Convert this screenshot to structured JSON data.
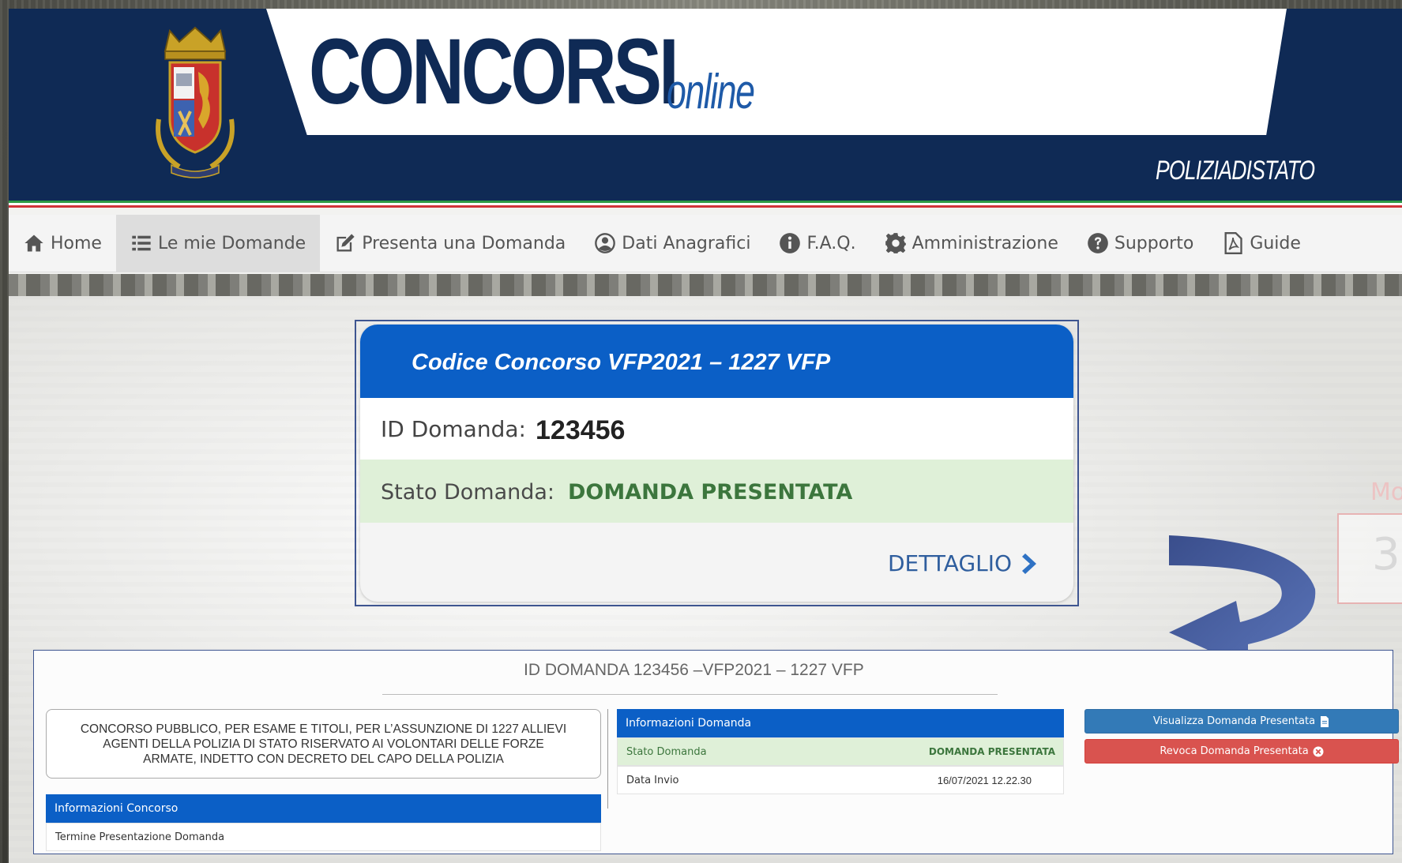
{
  "brand": {
    "title_main": "CONCORSI",
    "title_sub": "online",
    "right_label": "POLIZIADISTATO"
  },
  "colors": {
    "header_navy": "#0f2a55",
    "card_blue": "#0b5fc6",
    "success_bg": "#dff0d8",
    "success_text": "#3c763d",
    "tricolor": [
      "#2e9a46",
      "#ffffff",
      "#d1333a"
    ]
  },
  "nav": {
    "items": [
      {
        "label": "Home",
        "icon": "home-icon"
      },
      {
        "label": "Le mie Domande",
        "icon": "list-icon",
        "active": true
      },
      {
        "label": "Presenta una Domanda",
        "icon": "edit-icon"
      },
      {
        "label": "Dati Anagrafici",
        "icon": "user-circle-icon"
      },
      {
        "label": "F.A.Q.",
        "icon": "info-icon"
      },
      {
        "label": "Amministrazione",
        "icon": "gear-icon"
      },
      {
        "label": "Supporto",
        "icon": "question-icon"
      },
      {
        "label": "Guide",
        "icon": "pdf-icon"
      }
    ]
  },
  "card": {
    "header": "Codice Concorso VFP2021 – 1227 VFP",
    "id_label": "ID Domanda:",
    "id_value": "123456",
    "status_label": "Stato Domanda:",
    "status_value": "DOMANDA PRESENTATA",
    "detail_label": "DETTAGLIO"
  },
  "panel": {
    "title": "ID DOMANDA 123456 –VFP2021 – 1227 VFP",
    "concorso_description": "CONCORSO PUBBLICO, PER ESAME E TITOLI, PER L’ASSUNZIONE DI 1227 ALLIEVI AGENTI DELLA POLIZIA DI STATO RISERVATO AI VOLONTARI DELLE FORZE ARMATE, INDETTO CON DECRETO DEL CAPO DELLA POLIZIA",
    "info_concorso": {
      "header": "Informazioni Concorso",
      "rows": [
        "Termine Presentazione Domanda"
      ]
    },
    "info_domanda": {
      "header": "Informazioni Domanda",
      "stato_label": "Stato Domanda",
      "stato_value": "DOMANDA PRESENTATA",
      "data_label": "Data Invio",
      "data_value": "16/07/2021 12.22.30"
    },
    "buttons": {
      "view": "Visualizza Domanda Presentata",
      "revoke": "Revoca Domanda Presentata"
    }
  },
  "edge_fragment": {
    "red_text": "Mo",
    "number": "3"
  }
}
